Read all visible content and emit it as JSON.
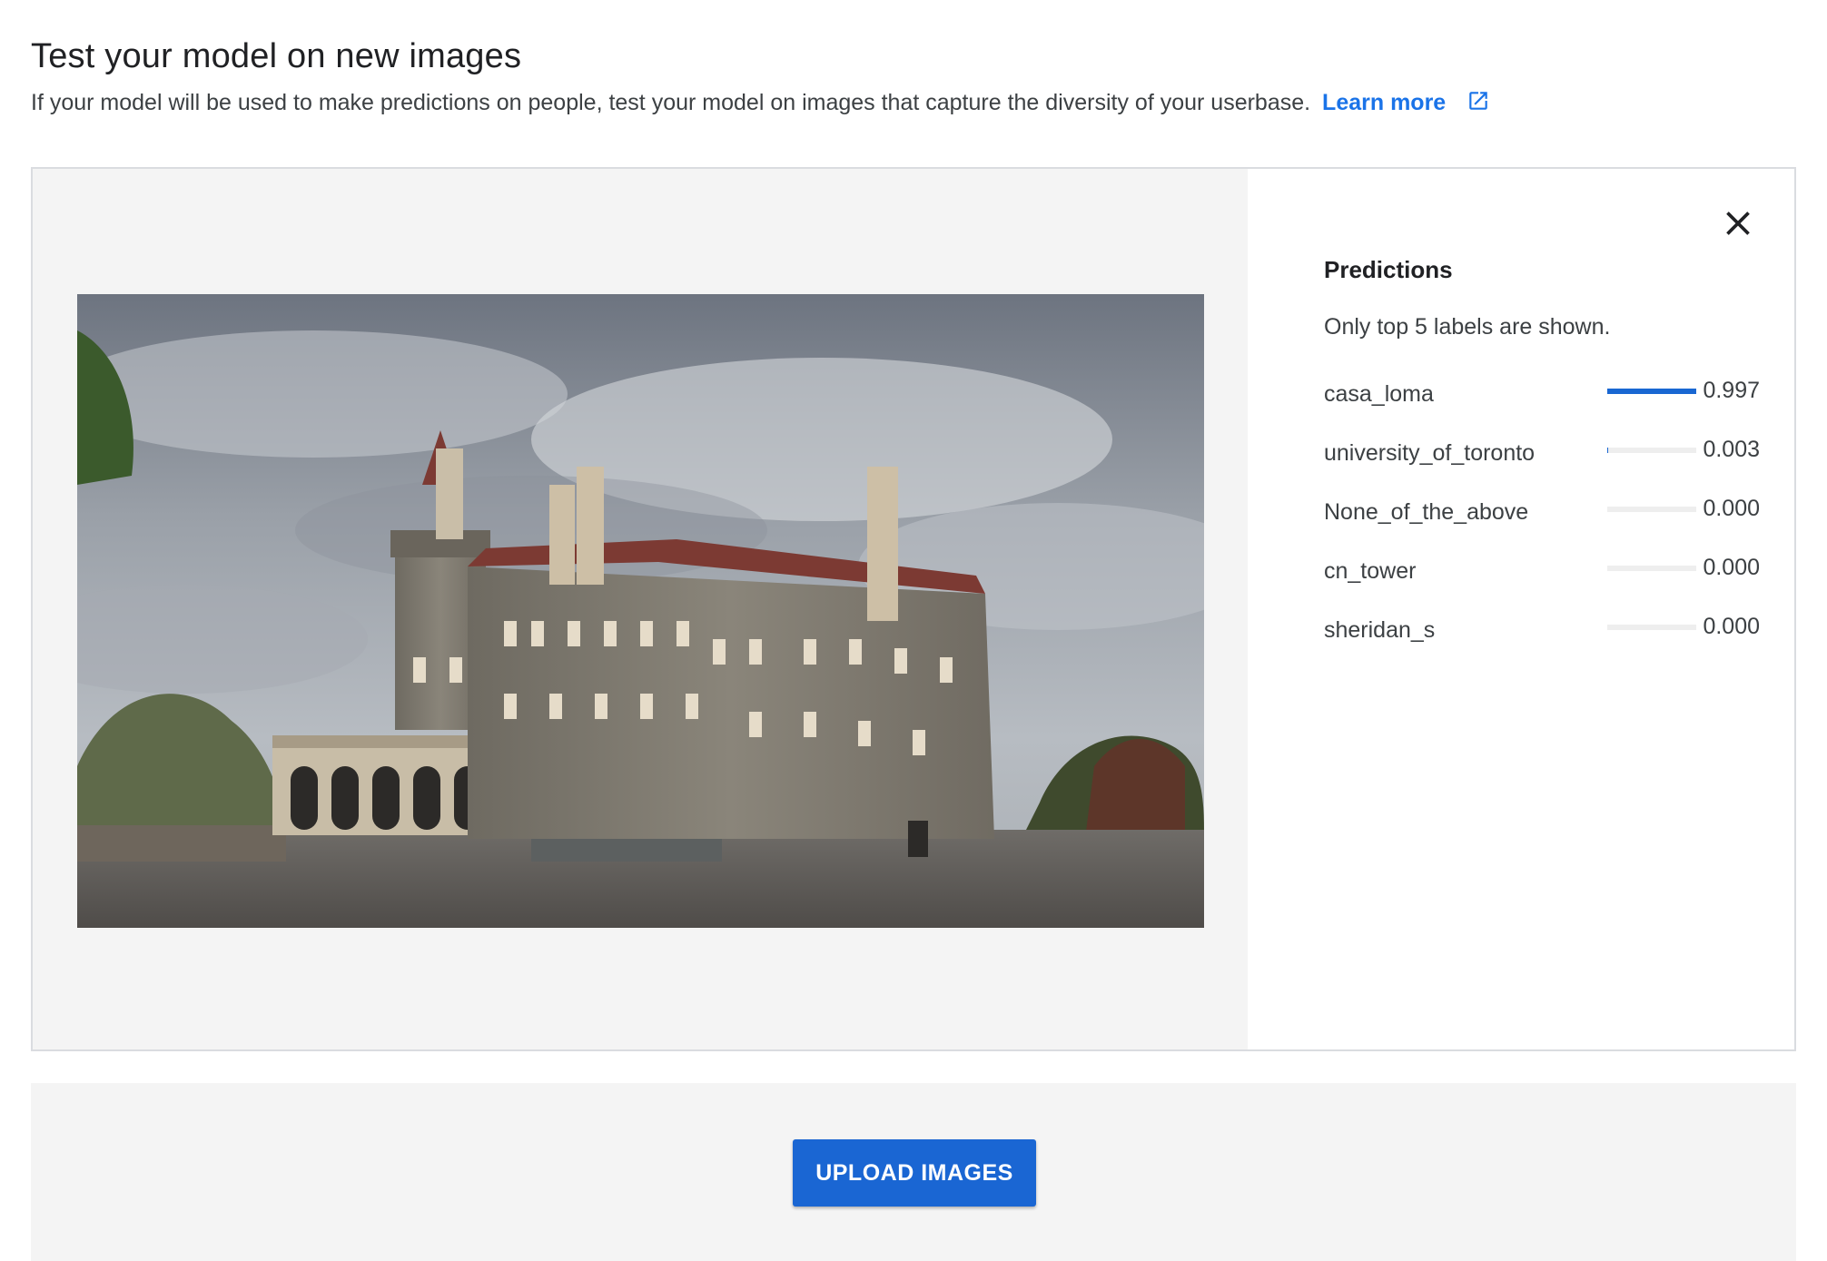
{
  "header": {
    "title": "Test your model on new images",
    "description": "If your model will be used to make predictions on people, test your model on images that capture the diversity of your userbase.",
    "learn_more_label": "Learn more"
  },
  "preview": {
    "image_alt": "Photo of a stone castle under a cloudy sky"
  },
  "predictions": {
    "title": "Predictions",
    "note": "Only top 5 labels are shown.",
    "items": [
      {
        "label": "casa_loma",
        "score": "0.997",
        "fraction": 0.997
      },
      {
        "label": "university_of_toronto",
        "score": "0.003",
        "fraction": 0.003
      },
      {
        "label": "None_of_the_above",
        "score": "0.000",
        "fraction": 0.0
      },
      {
        "label": "cn_tower",
        "score": "0.000",
        "fraction": 0.0
      },
      {
        "label": "sheridan_s",
        "score": "0.000",
        "fraction": 0.0
      }
    ]
  },
  "actions": {
    "upload_label": "UPLOAD IMAGES"
  },
  "colors": {
    "accent": "#1a73e8",
    "bar_fill": "#1967d2",
    "bar_track": "#eeeeee",
    "panel_bg": "#f4f4f4"
  },
  "icons": {
    "external_link": "open-in-new-icon",
    "close": "close-icon"
  }
}
